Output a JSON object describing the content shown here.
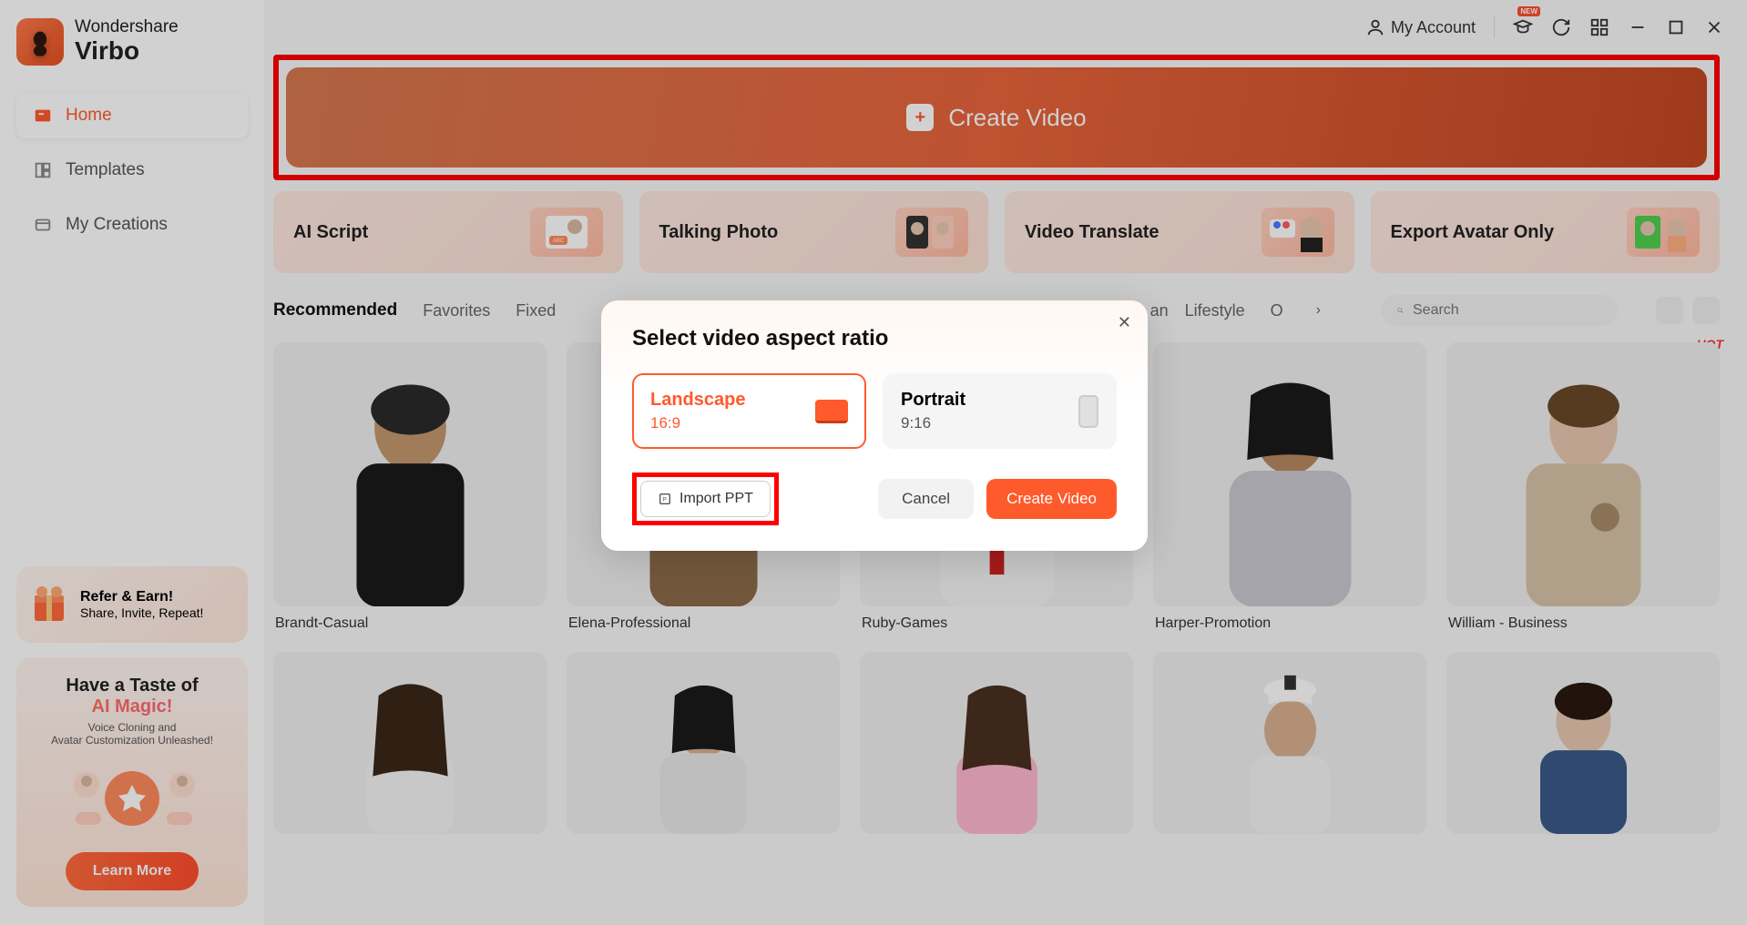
{
  "app": {
    "brand": "Wondershare",
    "name": "Virbo"
  },
  "topbar": {
    "account": "My Account",
    "new": "NEW"
  },
  "sidebar": {
    "items": [
      {
        "label": "Home",
        "active": true
      },
      {
        "label": "Templates",
        "active": false
      },
      {
        "label": "My Creations",
        "active": false
      }
    ]
  },
  "promo1": {
    "title": "Refer & Earn!",
    "sub": "Share, Invite, Repeat!"
  },
  "promo2": {
    "line1": "Have a Taste of",
    "line2": "AI Magic!",
    "sub1": "Voice Cloning and",
    "sub2": "Avatar Customization Unleashed!",
    "cta": "Learn More"
  },
  "create": {
    "label": "Create Video"
  },
  "features": [
    {
      "label": "AI Script"
    },
    {
      "label": "Talking Photo"
    },
    {
      "label": "Video Translate"
    },
    {
      "label": "Export Avatar Only"
    }
  ],
  "tabs": [
    "Recommended",
    "Favorites",
    "Fixed",
    "Lifestyle",
    "O"
  ],
  "tabs_hidden_hint": "an",
  "search": {
    "placeholder": "Search"
  },
  "avatars_row1": [
    {
      "name": "Brandt-Casual"
    },
    {
      "name": "Elena-Professional"
    },
    {
      "name": "Ruby-Games"
    },
    {
      "name": "Harper-Promotion"
    },
    {
      "name": "William - Business",
      "hot": true
    }
  ],
  "hot_label": "HOT",
  "modal": {
    "title": "Select video aspect ratio",
    "options": [
      {
        "label": "Landscape",
        "ratio": "16:9",
        "selected": true
      },
      {
        "label": "Portrait",
        "ratio": "9:16",
        "selected": false
      }
    ],
    "import": "Import PPT",
    "cancel": "Cancel",
    "create": "Create Video"
  }
}
